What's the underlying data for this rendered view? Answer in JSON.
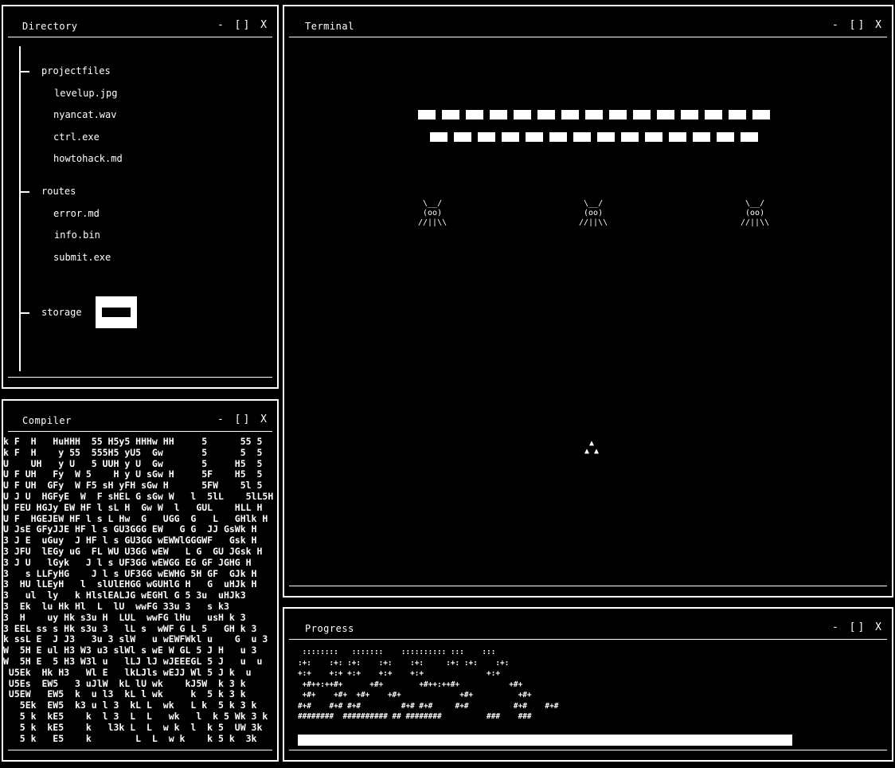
{
  "windows": {
    "directory": {
      "title": "Directory",
      "controls": "- [] X"
    },
    "compiler": {
      "title": "Compiler",
      "controls": "- [] X"
    },
    "terminal": {
      "title": "Terminal",
      "controls": "- [] X"
    },
    "progress": {
      "title": "Progress",
      "controls": "- [] X"
    }
  },
  "directory": {
    "folders": [
      {
        "name": "projectfiles",
        "files": [
          "levelup.jpg",
          "nyancat.wav",
          "ctrl.exe",
          "howtohack.md"
        ]
      },
      {
        "name": "routes",
        "files": [
          "error.md",
          "info.bin",
          "submit.exe"
        ]
      },
      {
        "name": "storage",
        "files": []
      }
    ]
  },
  "terminal": {
    "alien_art": " \\__/\n (oo)\n//||\\\\",
    "ship_art": " ▲\n▲ ▲"
  },
  "compiler": {
    "output": "k F  H   HuHHH  55 H5y5 HHHw HH     5      55 5\nk F  H    y 55  555H5 yU5  Gw       5      5  5\nU    UH   y U   5 UUH y U  Gw       5     H5  5\nU F UH   Fy  W 5    H y U sGw H     5F    H5  5\nU F UH  GFy  W F5 sH yFH sGw H      5FW    5l 5\nU J U  HGFyE  W  F sHEL G sGw W   l  5lL    5lL5H\nU FEU HGJy EW HF l sL H  Gw W  l   GUL    HLL H\nU F  HGEJEW HF l s L Hw  G   UGG  G   L   GHlk H\nU JsE GFyJJE HF l s GU3GGG EW   G G  JJ GsWk H\n3 J E  uGuy  J HF l s GU3GG wEWWlGGGWF   Gsk H\n3 JFU  lEGy uG  FL WU U3GG wEW   L G  GU JGsk H\n3 J U   lGyk   J l s UF3GG wEWGG EG GF JGHG H\n3   s LLFyHG    J l s UF3GG wEWHG 5H GF  GJk H\n3  HU lLEyH   l  slUlEHGG wGUHlG H   G  uHJk H\n3   ul  ly   k HlslEALJG wEGHl G 5 3u  uHJk3\n3  Ek  lu Hk Hl  L  lU  wwFG 33u 3   s k3\n3  H    uy Hk s3u H  LUL  wwFG lHu   usH k 3\n3 EEL ss s Hk s3u 3   lL s  wWF G L 5   GH k 3\nk ssL E  J J3   3u 3 slW   u wEWFWkl u    G  u 3\nW  5H E ul H3 W3 u3 slWl s wE W GL 5 J H   u 3\nW  5H E  5 H3 W3l u   lLJ lJ wJEEEGL 5 J   u  u\n U5Ek  Hk H3   Wl E   lkLJls wEJJ Wl 5 J k  u\n U5Es  EW5   3 uJlW  kL lU wk    kJ5W  k 3 k\n U5EW   EW5  k  u l3  kL l wk     k  5 k 3 k\n   5Ek  EW5  k3 u l 3  kL L  wk   L k  5 k 3 k\n   5 k  kE5    k  l 3  L  L   wk   l  k 5 Wk 3 k\n   5 k  kE5    k   l3k L  L  w k  l  k 5  UW 3k\n   5 k   E5    k        L  L  w k    k 5 k  3k"
  },
  "progress": {
    "ascii_art": " ::::::::   :::::::    :::::::::: :::    :::\n:+:    :+: :+:    :+:    :+:     :+: :+:    :+:\n+:+    +:+ +:+    +:+    +:+              +:+\n +#++:++#+      +#+        +#++:++#+           +#+\n +#+    +#+  +#+    +#+             +#+          +#+\n#+#    #+# #+#         #+# #+#     #+#          #+#    #+#\n########  ########## ## ########          ###    ###",
    "percent": 85
  }
}
